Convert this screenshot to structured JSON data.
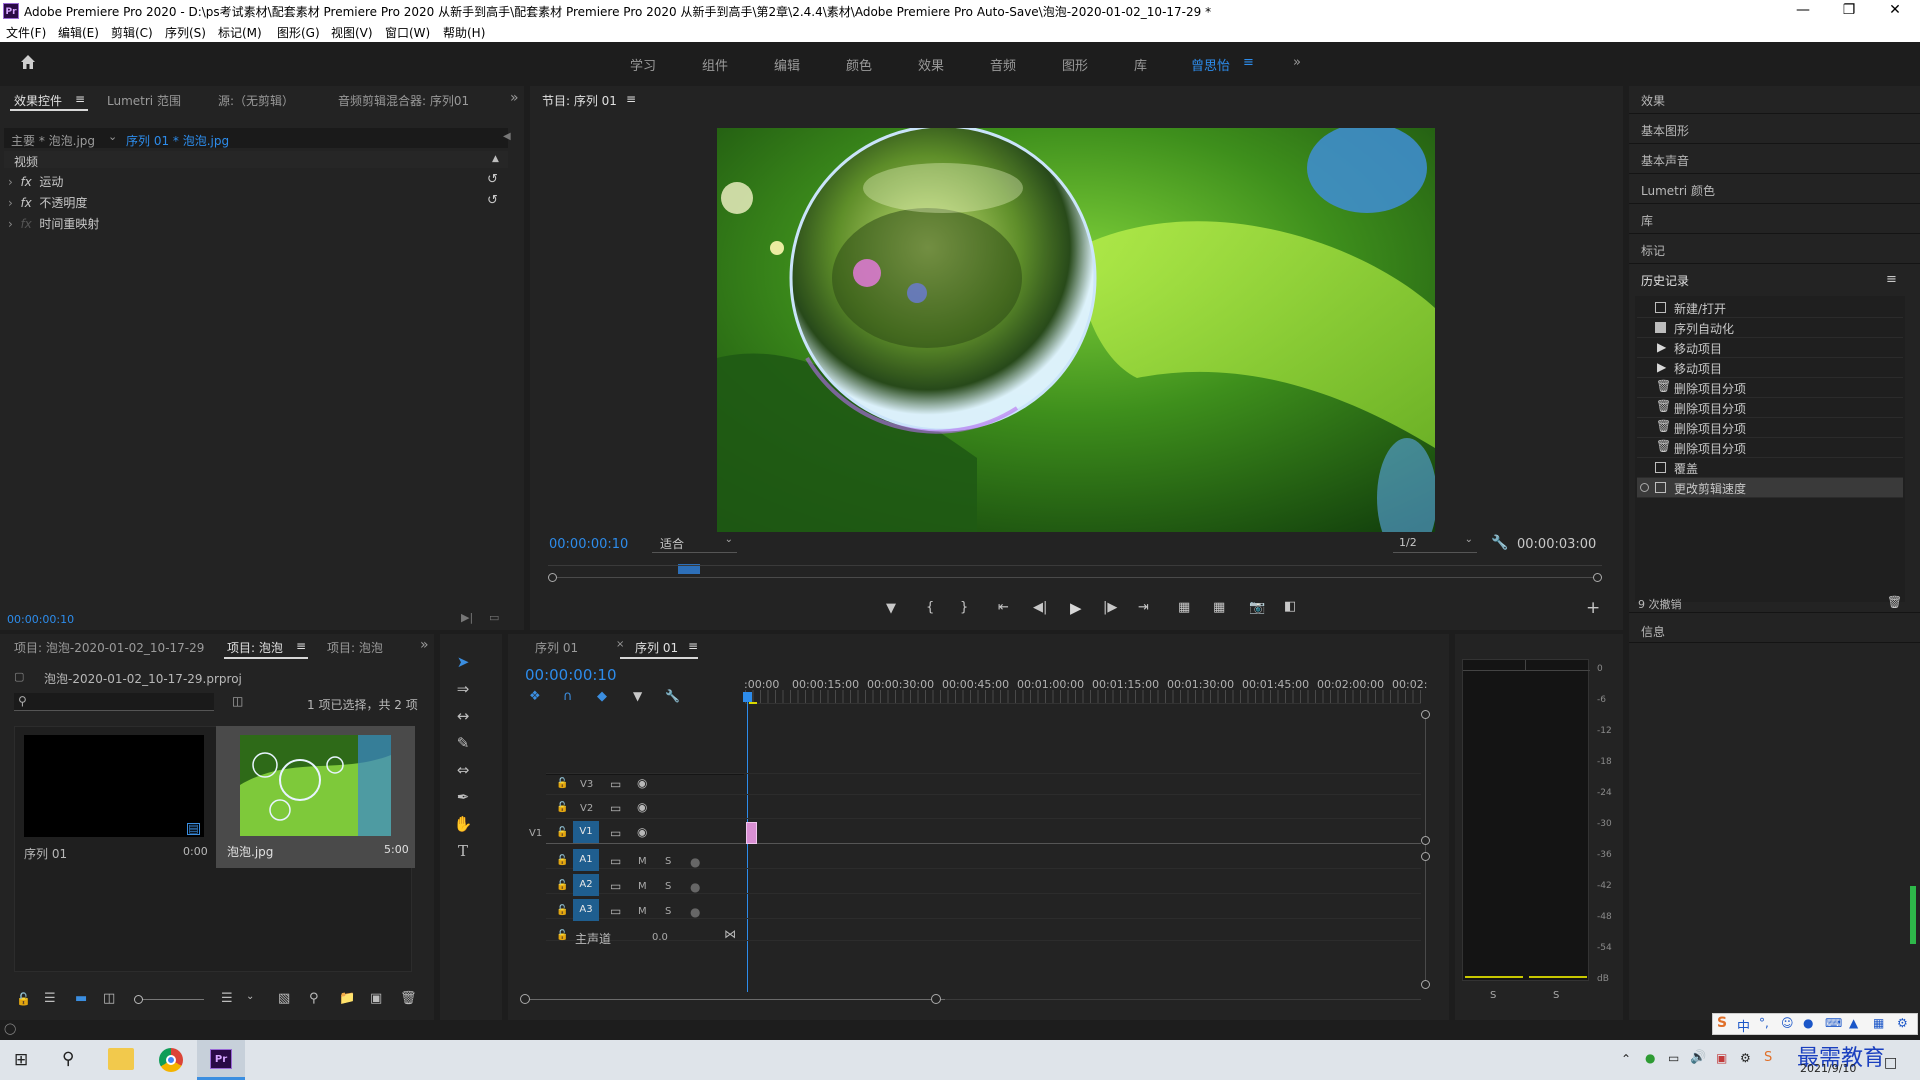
{
  "window": {
    "title": "Adobe Premiere Pro 2020 - D:\\ps考试素材\\配套素材 Premiere Pro 2020 从新手到高手\\配套素材 Premiere Pro 2020 从新手到高手\\第2章\\2.4.4\\素材\\Adobe Premiere Pro Auto-Save\\泡泡-2020-01-02_10-17-29 *",
    "logo": "Pr"
  },
  "menu": [
    "文件(F)",
    "编辑(E)",
    "剪辑(C)",
    "序列(S)",
    "标记(M)",
    "图形(G)",
    "视图(V)",
    "窗口(W)",
    "帮助(H)"
  ],
  "workspaces": [
    "学习",
    "组件",
    "编辑",
    "颜色",
    "效果",
    "音频",
    "图形",
    "库",
    "曾思怡"
  ],
  "effect_controls": {
    "tabs": [
      "效果控件",
      "Lumetri 范围",
      "源:（无剪辑）",
      "音频剪辑混合器: 序列01"
    ],
    "master_clip": "主要 * 泡泡.jpg",
    "sequence_clip": "序列 01 * 泡泡.jpg",
    "section": "视频",
    "effects": [
      "运动",
      "不透明度",
      "时间重映射"
    ],
    "fx_label": "fx",
    "timecode": "00:00:00:10"
  },
  "program_monitor": {
    "title": "节目: 序列 01",
    "timecode": "00:00:00:10",
    "zoom": "适合",
    "resolution": "1/2",
    "duration": "00:00:03:00"
  },
  "right_panel": {
    "items": [
      "效果",
      "基本图形",
      "基本声音",
      "Lumetri 颜色",
      "库",
      "标记"
    ],
    "history_title": "历史记录",
    "history": [
      "新建/打开",
      "序列自动化",
      "移动项目",
      "移动项目",
      "删除项目分项",
      "删除项目分项",
      "删除项目分项",
      "删除项目分项",
      "覆盖",
      "更改剪辑速度"
    ],
    "undo_count": "9 次撤销",
    "info": "信息"
  },
  "project": {
    "tabs": [
      "项目: 泡泡-2020-01-02_10-17-29",
      "项目: 泡泡",
      "项目: 泡泡"
    ],
    "file": "泡泡-2020-01-02_10-17-29.prproj",
    "selection": "1 项已选择，共 2 项",
    "items": [
      {
        "name": "序列 01",
        "duration": "0:00"
      },
      {
        "name": "泡泡.jpg",
        "duration": "5:00"
      }
    ]
  },
  "timeline": {
    "tabs": [
      "序列 01",
      "序列 01"
    ],
    "timecode": "00:00:00:10",
    "ruler": [
      ":00:00",
      "00:00:15:00",
      "00:00:30:00",
      "00:00:45:00",
      "00:01:00:00",
      "00:01:15:00",
      "00:01:30:00",
      "00:01:45:00",
      "00:02:00:00",
      "00:02:"
    ],
    "video_tracks": [
      "V3",
      "V2",
      "V1"
    ],
    "audio_tracks": [
      "A1",
      "A2",
      "A3"
    ],
    "master": "主声道",
    "master_value": "0.0",
    "mute": "M",
    "solo": "S"
  },
  "meter": {
    "scale": [
      "0",
      "-6",
      "-12",
      "-18",
      "-24",
      "-30",
      "-36",
      "-42",
      "-48",
      "-54",
      "dB"
    ],
    "solo": [
      "S",
      "S"
    ]
  },
  "taskbar": {
    "date": "2021/9/10",
    "watermark": "最需教育",
    "ime": "中"
  }
}
